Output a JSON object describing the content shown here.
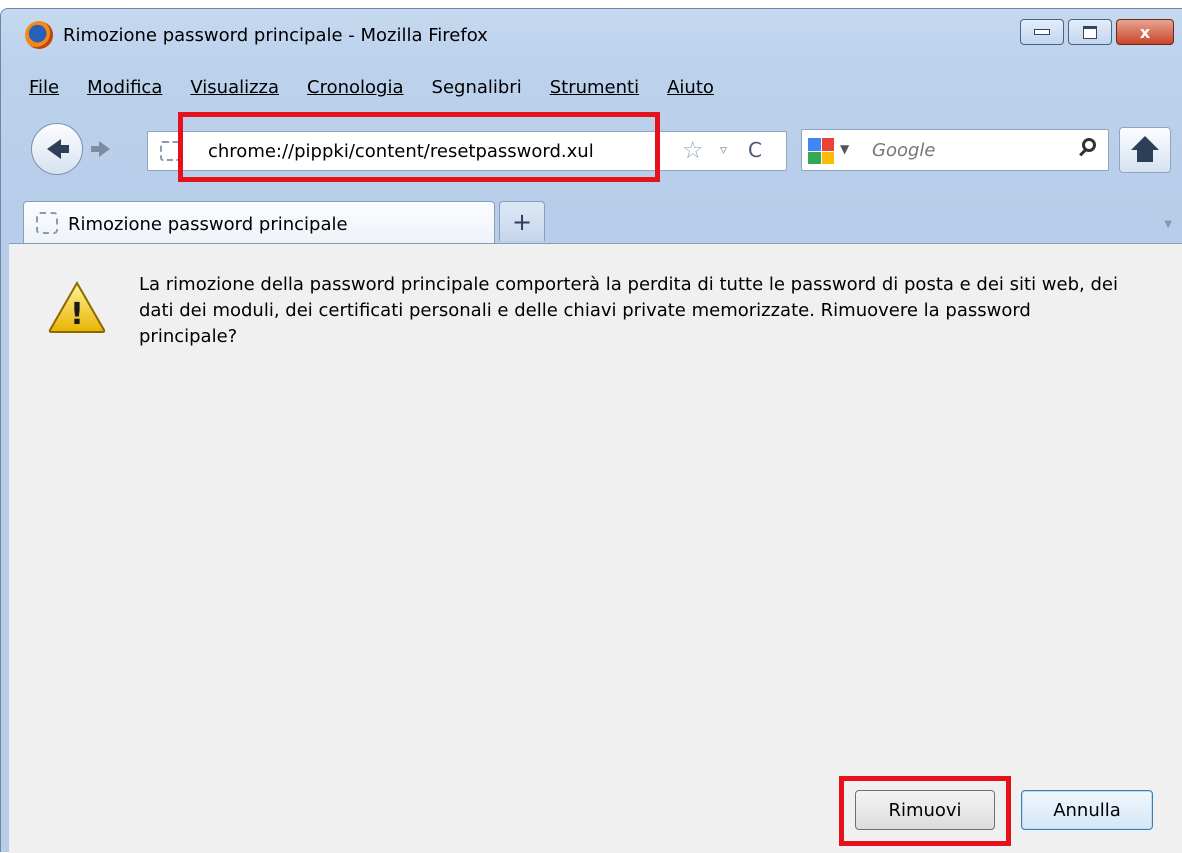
{
  "window": {
    "title": "Rimozione password principale - Mozilla Firefox",
    "close_label": "x"
  },
  "menu": {
    "items": [
      "File",
      "Modifica",
      "Visualizza",
      "Cronologia",
      "Segnalibri",
      "Strumenti",
      "Aiuto"
    ]
  },
  "navbar": {
    "url": "chrome://pippki/content/resetpassword.xul",
    "search_placeholder": "Google",
    "star_glyph": "☆",
    "dropdown_glyph": "▿",
    "reload_glyph": "C"
  },
  "tabs": {
    "active_label": "Rimozione password principale",
    "newtab_label": "+"
  },
  "dialog": {
    "message": "La rimozione della password principale comporterà la perdita di tutte le password di posta e dei siti web, dei dati dei moduli, dei certificati personali e delle chiavi private memorizzate. Rimuovere la password principale?",
    "warning_glyph": "!",
    "remove_button": "Rimuovi",
    "cancel_button": "Annulla"
  },
  "colors": {
    "highlight": "#e5121b",
    "chrome_bg": "#bcd2ec"
  }
}
